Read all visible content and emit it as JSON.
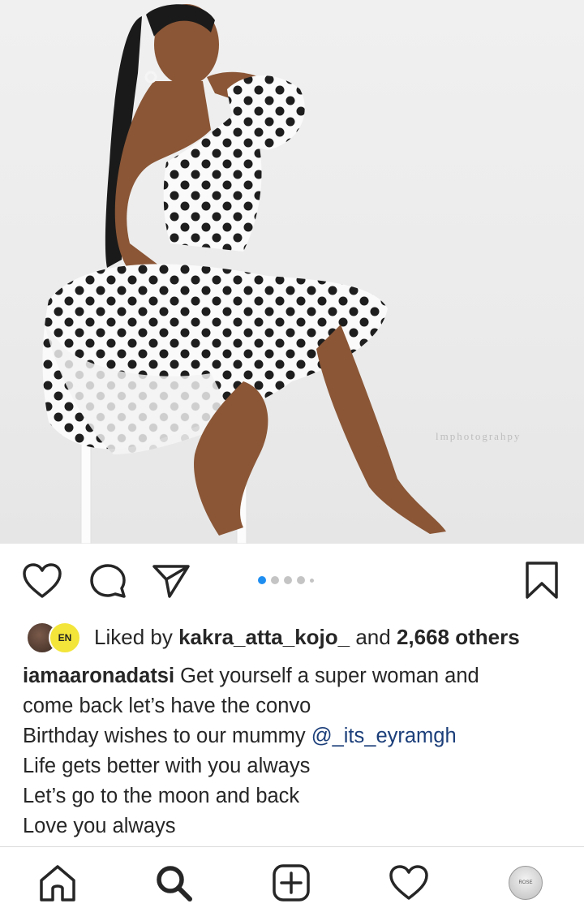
{
  "photo": {
    "watermark": "lmphotograhpy",
    "description_icon": "polka-dot-dress-photo"
  },
  "carousel": {
    "total_dots": 5,
    "active_index": 0,
    "active_color": "#1f8ef1"
  },
  "actions": {
    "like_icon": "heart-icon",
    "comment_icon": "comment-icon",
    "share_icon": "send-icon",
    "save_icon": "bookmark-icon"
  },
  "likes": {
    "prefix": "Liked by ",
    "user": "kakra_atta_kojo_",
    "middle": " and ",
    "count": "2,668 others",
    "avatar2_text": "EN"
  },
  "caption": {
    "username": "iamaaronadatsi",
    "line1": " Get yourself a super woman and",
    "line2": "come back let’s have the convo",
    "line3_text": "Birthday wishes to our mummy ",
    "mention": "@_its_eyramgh",
    "line4": "Life gets better with you always",
    "line5": "Let’s go to the moon and back",
    "line6": "Love you always",
    "mention_color": "#1c3f7a"
  },
  "nav": {
    "home_icon": "home-icon",
    "search_icon": "search-icon",
    "add_icon": "add-post-icon",
    "activity_icon": "heart-icon",
    "profile_text": "ROSE"
  }
}
